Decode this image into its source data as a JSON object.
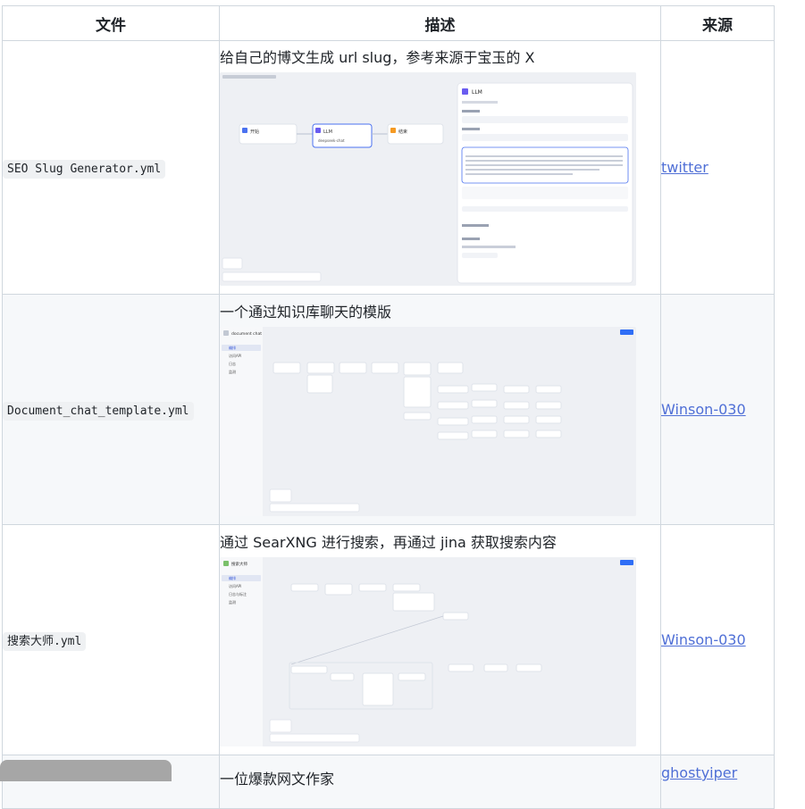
{
  "table": {
    "headers": {
      "file": "文件",
      "desc": "描述",
      "source": "来源"
    },
    "rows": [
      {
        "file": "SEO Slug Generator.yml",
        "description": "给自己的博文生成 url slug，参考来源于宝玉的 X",
        "source": "twitter",
        "preview": {
          "node_start": "开始",
          "node_llm": "LLM",
          "node_end": "结束",
          "panel_title": "LLM",
          "model": "deepseek-chat"
        }
      },
      {
        "file": "Document_chat_template.yml",
        "description": "一个通过知识库聊天的模版",
        "source": "Winson-030",
        "preview": {
          "app_name": "document chat",
          "sidebar": [
            "编排",
            "访问API",
            "日志",
            "监测"
          ]
        }
      },
      {
        "file": "搜索大师.yml",
        "description": "通过 SearXNG 进行搜索，再通过 jina 获取搜索内容",
        "source": "Winson-030",
        "preview": {
          "app_name": "搜索大师",
          "sidebar": [
            "编排",
            "访问API",
            "日志与标注",
            "监测"
          ]
        }
      },
      {
        "file": "",
        "description": "一位爆款网文作家",
        "source": "ghostyiper"
      }
    ]
  },
  "colors": {
    "link": "#4f6fd6",
    "border": "#d0d7de",
    "accent": "#2f6ef6"
  }
}
